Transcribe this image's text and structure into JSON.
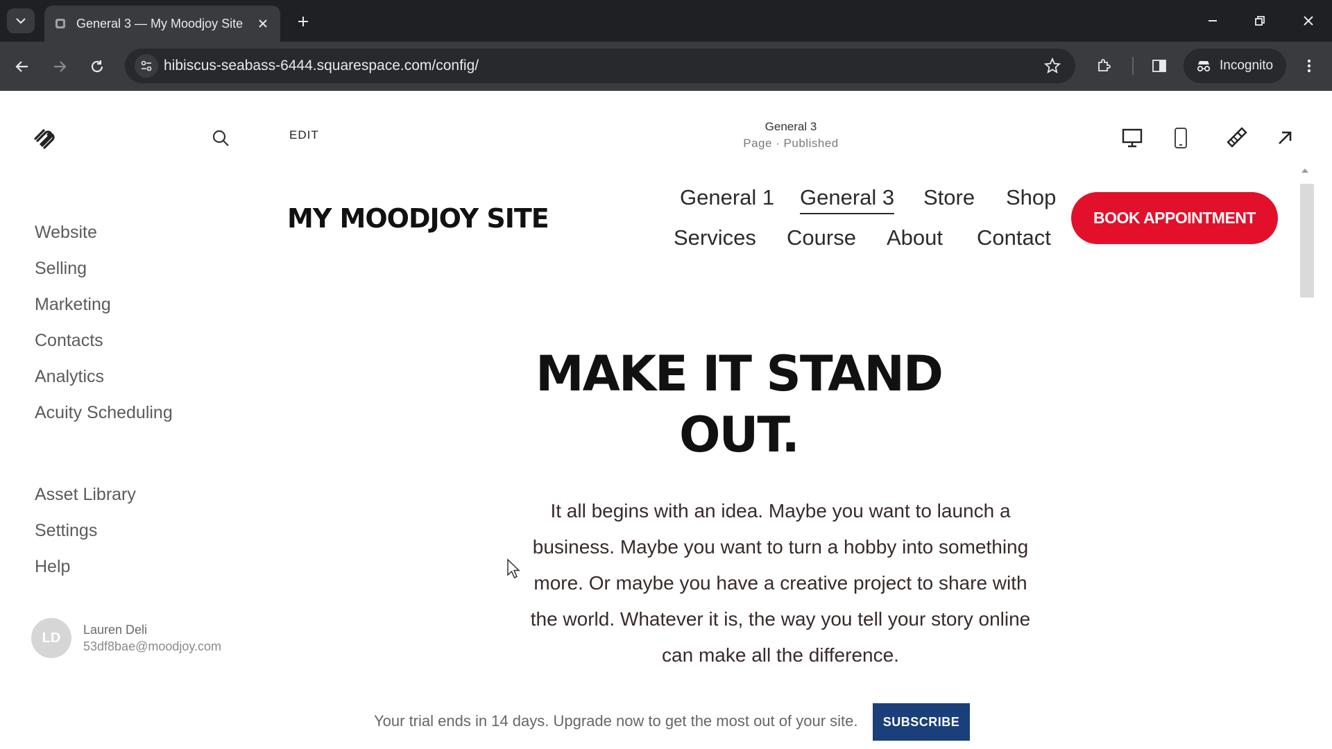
{
  "browser": {
    "tab_title": "General 3 — My Moodjoy Site",
    "url": "hibiscus-seabass-6444.squarespace.com/config/",
    "profile_label": "Incognito"
  },
  "header": {
    "edit_label": "EDIT",
    "page_name": "General 3",
    "page_status": "Page · Published"
  },
  "sidebar": {
    "items": [
      "Website",
      "Selling",
      "Marketing",
      "Contacts",
      "Analytics",
      "Acuity Scheduling"
    ],
    "secondary_items": [
      "Asset Library",
      "Settings",
      "Help"
    ],
    "user": {
      "initials": "LD",
      "name": "Lauren Deli",
      "email": "53df8bae@moodjoy.com"
    }
  },
  "site": {
    "title": "MY MOODJOY SITE",
    "nav": [
      "General 1",
      "General 3",
      "Store",
      "Shop",
      "Services",
      "Course",
      "About",
      "Contact"
    ],
    "active_nav": "General 3",
    "cta_label": "BOOK APPOINTMENT",
    "hero_title_line1": "MAKE IT STAND",
    "hero_title_line2": "OUT.",
    "hero_body": "It all begins with an idea. Maybe you want to launch a business. Maybe you want to turn a hobby into something more. Or maybe you have a creative project to share with the world. Whatever it is, the way you tell your story online can make all the difference."
  },
  "trial_banner": {
    "text": "Your trial ends in 14 days. Upgrade now to get the most out of your site.",
    "button_label": "SUBSCRIBE"
  },
  "colors": {
    "cta_red": "#e3102b",
    "subscribe_navy": "#1b3f7a",
    "chrome_dark": "#1f2023",
    "chrome_toolbar": "#3a3b3f"
  },
  "icons": [
    "tab-list-icon",
    "close-icon",
    "plus-icon",
    "minimize-icon",
    "restore-icon",
    "back-arrow-icon",
    "forward-arrow-icon",
    "reload-icon",
    "site-settings-icon",
    "star-icon",
    "extensions-icon",
    "side-panel-icon",
    "incognito-icon",
    "kebab-menu-icon",
    "squarespace-logo-icon",
    "search-icon",
    "desktop-icon",
    "mobile-icon",
    "design-brush-icon",
    "external-arrow-icon"
  ]
}
